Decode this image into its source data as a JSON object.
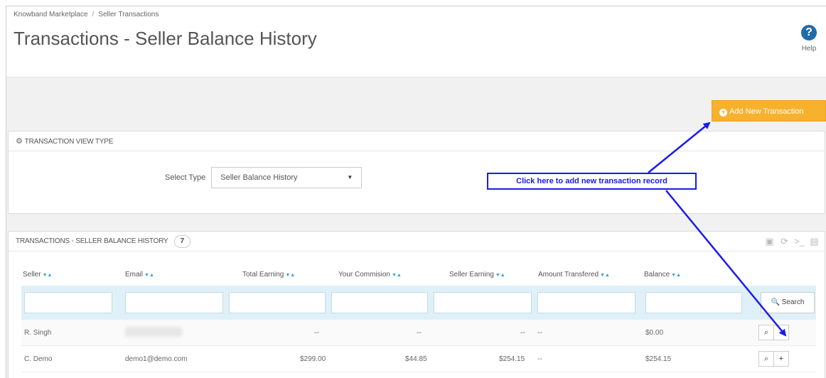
{
  "breadcrumb": {
    "root": "Knowband Marketplace",
    "separator": "/",
    "current": "Seller Transactions"
  },
  "page": {
    "title": "Transactions - Seller Balance History"
  },
  "help": {
    "label": "Help",
    "glyph": "?"
  },
  "toolbar": {
    "add_button_label": "Add New Transaction",
    "add_icon": "plus-circle-icon"
  },
  "view_type_panel": {
    "heading": "TRANSACTION VIEW TYPE",
    "select_label": "Select Type",
    "select_value": "Seller Balance History"
  },
  "callout": {
    "text": "Click here to add new transaction record"
  },
  "list_panel": {
    "heading": "TRANSACTIONS - SELLER BALANCE HISTORY",
    "count": "7",
    "columns": [
      "Seller",
      "Email",
      "Total Earning",
      "Your Commision",
      "Seller Earning",
      "Amount Transfered",
      "Balance"
    ],
    "sort_glyph": "▼▲",
    "search_label": "Search",
    "rows": [
      {
        "seller": "R. Singh",
        "email": "",
        "total_earning": "--",
        "your_commission": "--",
        "seller_earning": "--",
        "amount_transfered": "--",
        "balance": "$0.00"
      },
      {
        "seller": "C. Demo",
        "email": "demo1@demo.com",
        "total_earning": "$299.00",
        "your_commission": "$44.85",
        "seller_earning": "$254.15",
        "amount_transfered": "--",
        "balance": "$254.15"
      }
    ]
  },
  "colors": {
    "accent": "#f8b12c",
    "callout": "#1a1aef",
    "filter_bg": "#dff0f8",
    "sort": "#2d9fd9"
  }
}
